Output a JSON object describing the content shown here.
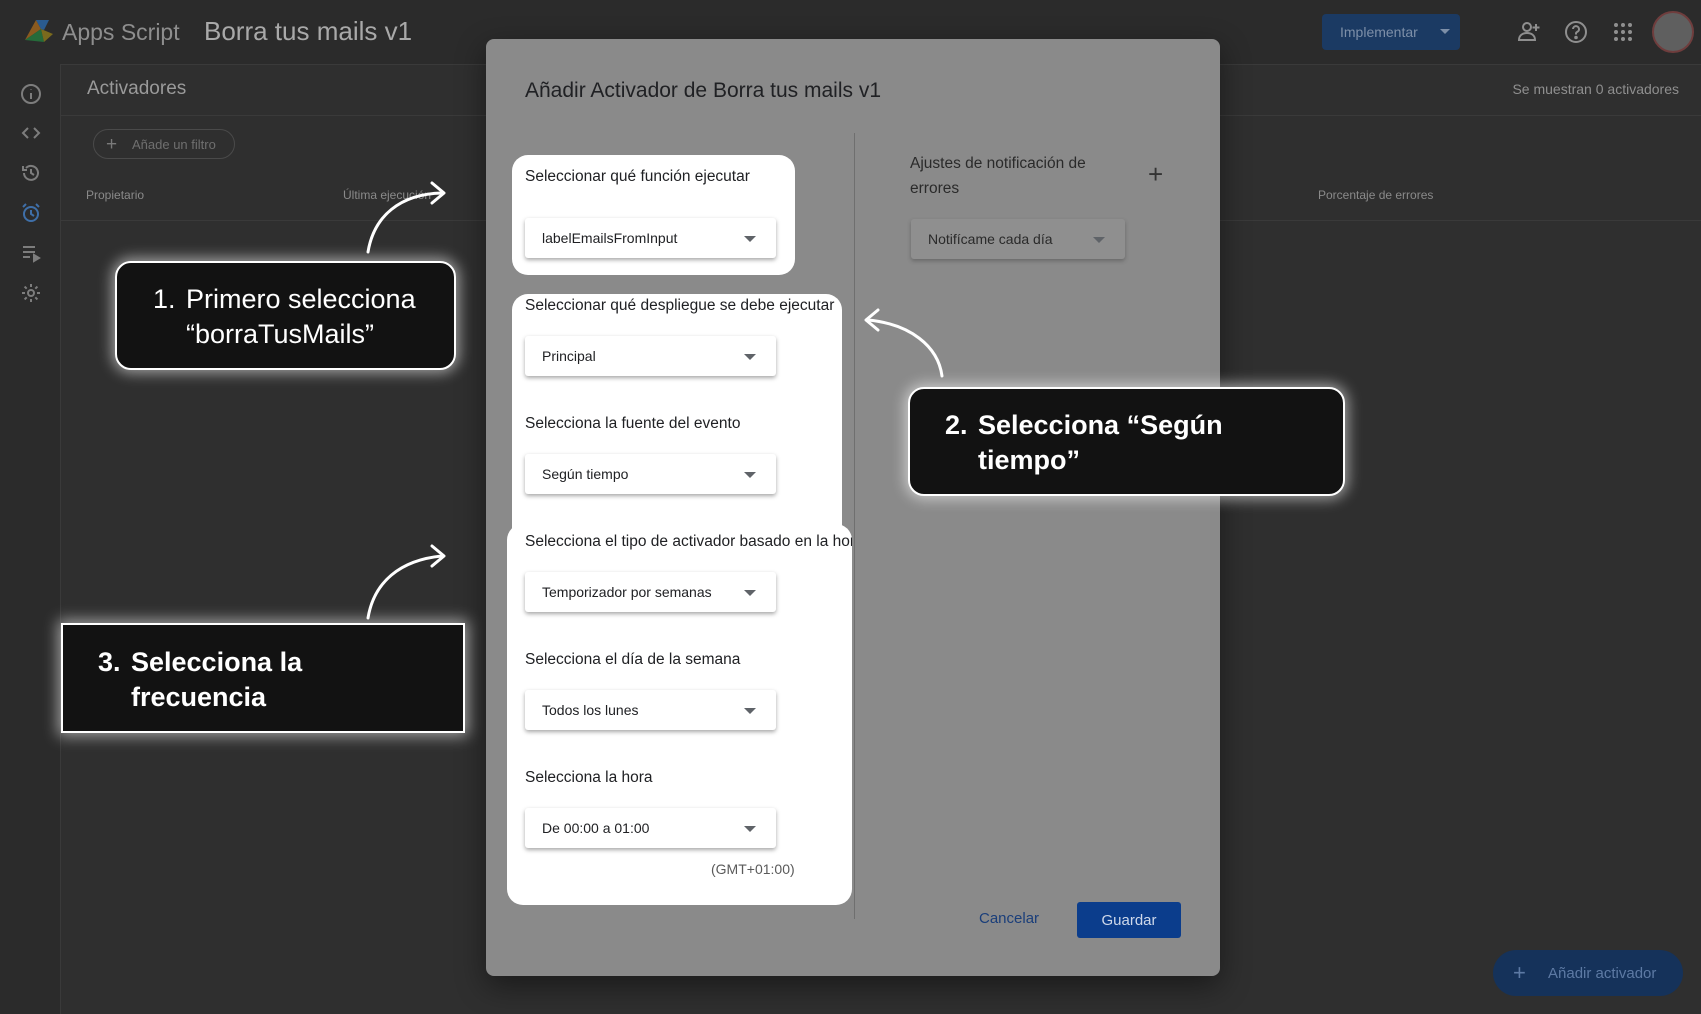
{
  "topbar": {
    "app_name": "Apps Script",
    "project_title": "Borra tus mails v1",
    "deploy_label": "Implementar",
    "icons": [
      "add-person-icon",
      "help-icon",
      "apps-grid-icon",
      "avatar"
    ]
  },
  "sidebar": {
    "icons": [
      "info-icon",
      "code-icon",
      "history-icon",
      "alarm-clock-icon",
      "executions-icon",
      "settings-icon"
    ]
  },
  "content": {
    "title": "Activadores",
    "count_text": "Se muestran 0 activadores",
    "filter_label": "Añade un filtro",
    "columns": [
      "Propietario",
      "Última ejecución",
      "Porcentaje de errores"
    ],
    "fab_label": "Añadir activador"
  },
  "dialog": {
    "title": "Añadir Activador de Borra tus mails v1",
    "fields": [
      {
        "label": "Seleccionar qué función ejecutar",
        "value": "labelEmailsFromInput"
      },
      {
        "label": "Seleccionar qué despliegue se debe ejecutar",
        "value": "Principal"
      },
      {
        "label": "Selecciona la fuente del evento",
        "value": "Según tiempo"
      },
      {
        "label": "Selecciona el tipo de activador basado en la hora",
        "value": "Temporizador por semanas"
      },
      {
        "label": "Selecciona el día de la semana",
        "value": "Todos los lunes"
      },
      {
        "label": "Selecciona la hora",
        "value": "De 00:00 a 01:00"
      }
    ],
    "timezone": "(GMT+01:00)",
    "notifications": {
      "title": "Ajustes de notificación de errores",
      "value": "Notifícame cada día"
    },
    "cancel_label": "Cancelar",
    "save_label": "Guardar"
  },
  "callouts": [
    {
      "number": "1.",
      "text_line1": "Primero selecciona",
      "text_line2": "“borraTusMails”"
    },
    {
      "number": "2.",
      "text_line1": "Selecciona “Según",
      "text_line2": "tiempo”"
    },
    {
      "number": "3.",
      "text_line1": "Selecciona la",
      "text_line2": "frecuencia"
    }
  ],
  "colors": {
    "overlay_bg": "#2f2f2f",
    "dialog_bg": "#8a8a8a",
    "primary_button": "#0b3d8c",
    "callout_bg": "#121212",
    "highlight": "#ffffff"
  }
}
